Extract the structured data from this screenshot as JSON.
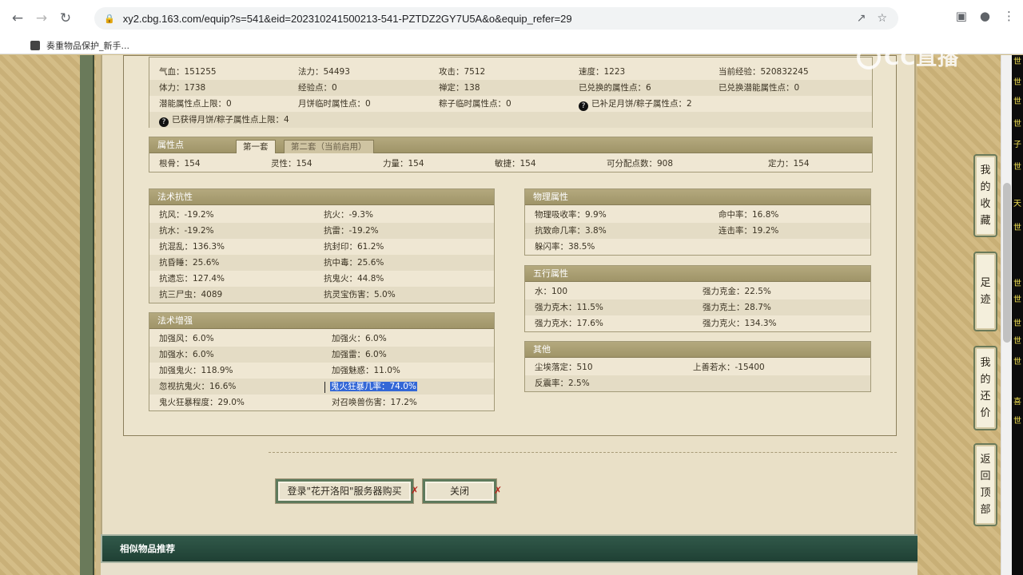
{
  "browser": {
    "url": "xy2.cbg.163.com/equip?s=541&eid=202310241500213-541-PZTDZ2GY7U5A&o&equip_refer=29",
    "bookmark": "奏重物品保护_新手..."
  },
  "watermark": "CC直播",
  "stats_top": {
    "rows": [
      [
        "气血：151255",
        "法力：54493",
        "攻击：7512",
        "速度：1223",
        "当前经验：520832245"
      ],
      [
        "体力：1738",
        "经验点：0",
        "禅定：138",
        "已兑换的属性点：6",
        "已兑换潜能属性点：0"
      ],
      [
        "潜能属性点上限：0",
        "月饼临时属性点：0",
        "粽子临时属性点：0",
        "已补足月饼/粽子属性点：2",
        ""
      ],
      [
        "已获得月饼/粽子属性点上限：4"
      ]
    ]
  },
  "attr_points": {
    "title": "属性点",
    "tab1": "第一套",
    "tab2": "第二套（当前启用）",
    "values": [
      "根骨：154",
      "灵性：154",
      "力量：154",
      "敏捷：154",
      "可分配点数：908",
      "定力：154"
    ]
  },
  "magic_resist": {
    "title": "法术抗性",
    "rows": [
      [
        "抗风：-19.2%",
        "抗火：-9.3%"
      ],
      [
        "抗水：-19.2%",
        "抗雷：-19.2%"
      ],
      [
        "抗混乱：136.3%",
        "抗封印：61.2%"
      ],
      [
        "抗昏睡：25.6%",
        "抗中毒：25.6%"
      ],
      [
        "抗遗忘：127.4%",
        "抗鬼火：44.8%"
      ],
      [
        "抗三尸虫：4089",
        "抗灵宝伤害：5.0%"
      ]
    ]
  },
  "magic_boost": {
    "title": "法术增强",
    "rows": [
      [
        "加强风：6.0%",
        "加强火：6.0%"
      ],
      [
        "加强水：6.0%",
        "加强雷：6.0%"
      ],
      [
        "加强鬼火：118.9%",
        "加强魅惑：11.0%"
      ],
      [
        "忽视抗鬼火：16.6%",
        "鬼火狂暴几率：74.0%"
      ],
      [
        "鬼火狂暴程度：29.0%",
        "对召唤兽伤害：17.2%"
      ]
    ]
  },
  "physical": {
    "title": "物理属性",
    "rows": [
      [
        "物理吸收率：9.9%",
        "命中率：16.8%"
      ],
      [
        "抗致命几率：3.8%",
        "连击率：19.2%"
      ],
      [
        "躲闪率：38.5%",
        ""
      ]
    ]
  },
  "five_elements": {
    "title": "五行属性",
    "rows": [
      [
        "水：100",
        "强力克金：22.5%"
      ],
      [
        "强力克木：11.5%",
        "强力克土：28.7%"
      ],
      [
        "强力克水：17.6%",
        "强力克火：134.3%"
      ]
    ]
  },
  "others": {
    "title": "其他",
    "rows": [
      [
        "尘埃落定：510",
        "上善若水：-15400"
      ],
      [
        "反震率：2.5%",
        ""
      ]
    ]
  },
  "buttons": {
    "login": "登录\"花开洛阳\"服务器购买",
    "close": "关闭"
  },
  "similar_title": "相似物品推荐",
  "side_tabs": {
    "favorites": [
      "我",
      "的",
      "收",
      "藏"
    ],
    "footprints": [
      "足",
      "迹"
    ],
    "my_offers": [
      "我",
      "的",
      "还",
      "价"
    ],
    "back_top": [
      "返",
      "回",
      "顶",
      "部"
    ]
  },
  "ticker": [
    "世",
    "世",
    "世",
    "世",
    "子",
    "世",
    "天",
    "世",
    "世",
    "世",
    "世",
    "世",
    "世",
    "喜",
    "世"
  ]
}
